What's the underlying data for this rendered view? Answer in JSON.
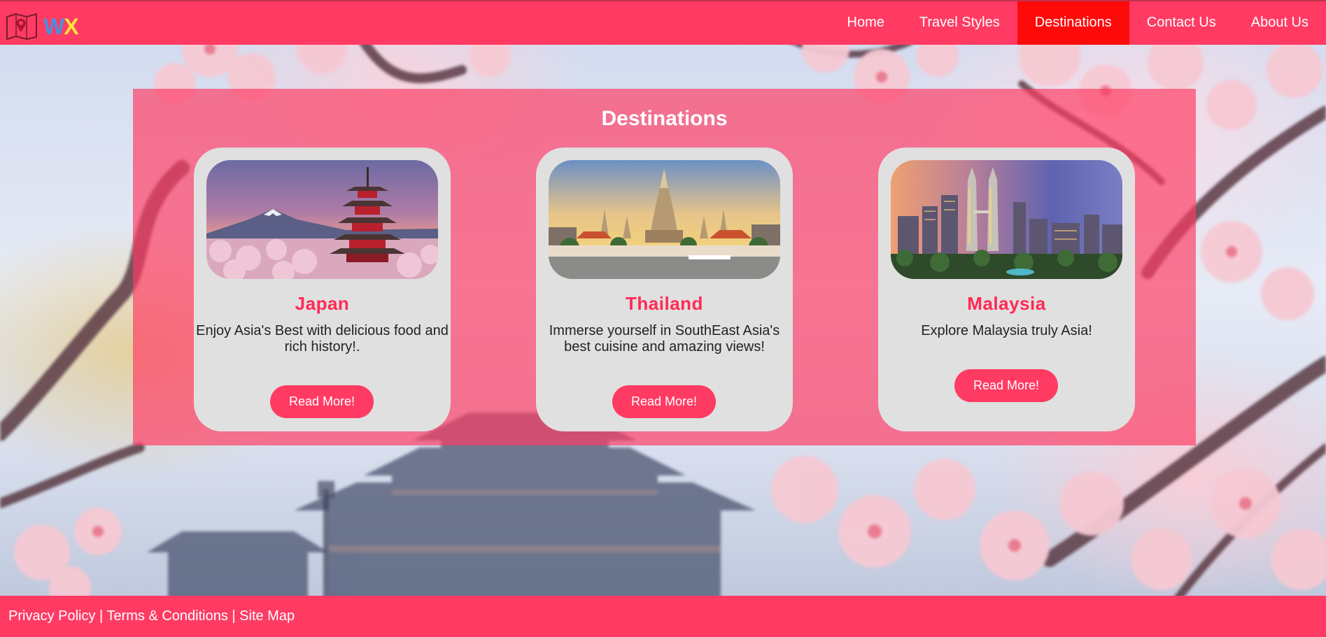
{
  "header": {
    "logo_letters": [
      "W",
      "X"
    ],
    "nav": [
      {
        "label": "Home",
        "active": false
      },
      {
        "label": "Travel Styles",
        "active": false
      },
      {
        "label": "Destinations",
        "active": true
      },
      {
        "label": "Contact Us",
        "active": false
      },
      {
        "label": "About Us",
        "active": false
      }
    ]
  },
  "main": {
    "title": "Destinations",
    "cards": [
      {
        "title": "Japan",
        "description": "Enjoy Asia's Best with delicious food and rich history!.",
        "button": "Read More!",
        "image_icon": "pagoda-mount-fuji-image"
      },
      {
        "title": "Thailand",
        "description": "Immerse yourself in SouthEast Asia's best cuisine and amazing views!",
        "button": "Read More!",
        "image_icon": "temple-river-image"
      },
      {
        "title": "Malaysia",
        "description": "Explore Malaysia truly Asia!",
        "button": "Read More!",
        "image_icon": "city-skyline-image"
      }
    ]
  },
  "footer": {
    "links": [
      "Privacy Policy",
      "Terms & Conditions",
      "Site Map"
    ],
    "separator": " | "
  },
  "colors": {
    "brand": "#ff3b63",
    "active_nav": "#ff0a0a",
    "card_title": "#ff2a55",
    "card_bg": "#e0e0e0",
    "logo_w": "#4a8fe0",
    "logo_x": "#ffe33b"
  }
}
